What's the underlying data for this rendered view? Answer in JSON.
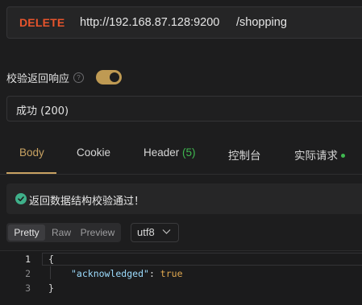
{
  "request": {
    "method": "DELETE",
    "url_base": "http://192.168.87.128:9200",
    "url_path": "/shopping"
  },
  "validation": {
    "label": "校验返回响应",
    "help_icon": "question-circle-icon",
    "toggle_on": true
  },
  "response_select": {
    "value": "成功 (200)"
  },
  "tabs": [
    {
      "label": "Body",
      "active": true
    },
    {
      "label": "Cookie"
    },
    {
      "label": "Header ",
      "count": "(5)"
    },
    {
      "label": "控制台"
    },
    {
      "label": "实际请求"
    }
  ],
  "alert": {
    "text": "返回数据结构校验通过！",
    "icon": "check-circle-icon"
  },
  "view_modes": [
    {
      "label": "Pretty",
      "active": true
    },
    {
      "label": "Raw"
    },
    {
      "label": "Preview"
    }
  ],
  "encoding": {
    "value": "utf8"
  },
  "code": {
    "line_numbers": [
      "1",
      "2",
      "3"
    ],
    "open_brace": "{",
    "key": "\"acknowledged\"",
    "separator": ": ",
    "value": "true",
    "close_brace": "}"
  },
  "colors": {
    "accent": "#c8a262",
    "method": "#e8542c",
    "success": "#3fb950"
  }
}
